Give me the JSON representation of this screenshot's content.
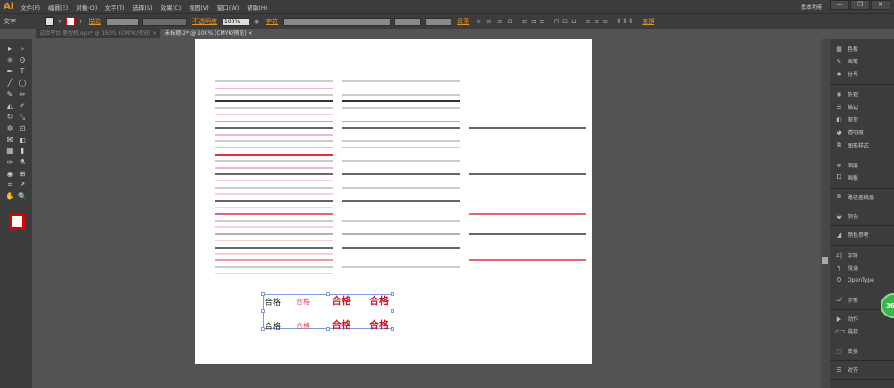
{
  "menubar": {
    "logo": "Ai",
    "items": [
      "文件(F)",
      "编辑(E)",
      "对象(O)",
      "文字(T)",
      "选择(S)",
      "效果(C)",
      "视图(V)",
      "窗口(W)",
      "帮助(H)"
    ],
    "workspace": "基本功能",
    "window_buttons": [
      "—",
      "❐",
      "✕"
    ]
  },
  "control": {
    "label": "文字",
    "stroke": "描边",
    "opacity": "不透明度",
    "opacity_value": "100%",
    "character": "字符",
    "paragraph": "段落",
    "transform": "变换"
  },
  "tabs": [
    {
      "label": "试验平台-原型机.eps* @ 150% (CMYK/预览)",
      "close": "×"
    },
    {
      "label": "未标题-2* @ 100% (CMYK/预览)",
      "close": "×"
    }
  ],
  "panels": [
    {
      "label": "色板",
      "icon": "swatches-icon"
    },
    {
      "label": "画笔",
      "icon": "brush-icon"
    },
    {
      "label": "符号",
      "icon": "symbol-icon"
    },
    {
      "label": "外观",
      "icon": "appearance-icon"
    },
    {
      "label": "描边",
      "icon": "stroke-icon"
    },
    {
      "label": "渐变",
      "icon": "gradient-icon"
    },
    {
      "label": "透明度",
      "icon": "transparency-icon"
    },
    {
      "label": "图形样式",
      "icon": "graphic-styles-icon"
    },
    {
      "label": "图层",
      "icon": "layers-icon"
    },
    {
      "label": "画板",
      "icon": "artboard-icon"
    },
    {
      "label": "路径查找器",
      "icon": "pathfinder-icon"
    },
    {
      "label": "颜色",
      "icon": "color-icon"
    },
    {
      "label": "颜色参考",
      "icon": "color-guide-icon"
    },
    {
      "label": "字符",
      "icon": "character-icon"
    },
    {
      "label": "段落",
      "icon": "paragraph-icon"
    },
    {
      "label": "OpenType",
      "icon": "opentype-icon"
    },
    {
      "label": "字形",
      "icon": "glyphs-icon"
    },
    {
      "label": "动作",
      "icon": "actions-icon"
    },
    {
      "label": "链接",
      "icon": "links-icon"
    },
    {
      "label": "变换",
      "icon": "transform-icon"
    },
    {
      "label": "对齐",
      "icon": "align-icon"
    }
  ],
  "artwork": {
    "text": "合格",
    "colors": {
      "dark": "#333333",
      "gray": "#999999",
      "pink": "#f4a0a8",
      "red": "#e03040"
    }
  },
  "badge": "360"
}
